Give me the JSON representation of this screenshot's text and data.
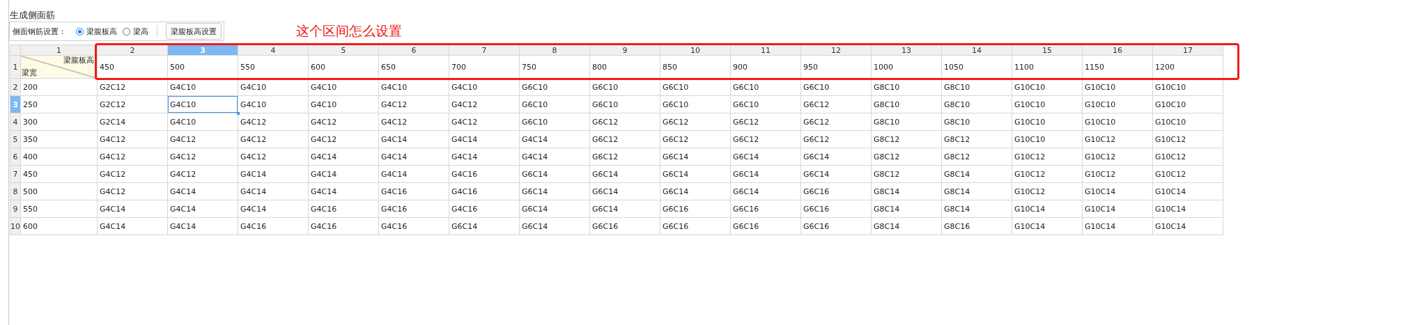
{
  "window": {
    "title": "生成侧面筋"
  },
  "toolbar": {
    "label": "侧面钢筋设置：",
    "options": [
      {
        "label": "梁腹板高",
        "selected": true
      },
      {
        "label": "梁高",
        "selected": false
      }
    ],
    "button": "梁腹板高设置"
  },
  "annotation": {
    "text": "这个区间怎么设置"
  },
  "table": {
    "columns": [
      {
        "label": "1",
        "selected": false
      },
      {
        "label": "2",
        "selected": false
      },
      {
        "label": "3",
        "selected": true
      },
      {
        "label": "4",
        "selected": false
      },
      {
        "label": "5",
        "selected": false
      },
      {
        "label": "6",
        "selected": false
      },
      {
        "label": "7",
        "selected": false
      },
      {
        "label": "8",
        "selected": false
      },
      {
        "label": "9",
        "selected": false
      },
      {
        "label": "10",
        "selected": false
      },
      {
        "label": "11",
        "selected": false
      },
      {
        "label": "12",
        "selected": false
      },
      {
        "label": "13",
        "selected": false
      },
      {
        "label": "14",
        "selected": false
      },
      {
        "label": "15",
        "selected": false
      },
      {
        "label": "16",
        "selected": false
      },
      {
        "label": "17",
        "selected": false
      }
    ],
    "corner": {
      "top_label": "梁腹板高",
      "bottom_label": "梁宽"
    },
    "header_row": {
      "label": "1",
      "selected": false,
      "values": [
        "450",
        "500",
        "550",
        "600",
        "650",
        "700",
        "750",
        "800",
        "850",
        "900",
        "950",
        "1000",
        "1050",
        "1100",
        "1150",
        "1200"
      ]
    },
    "rows": [
      {
        "label": "2",
        "selected": false,
        "cells": [
          "200",
          "G2C12",
          "G4C10",
          "G4C10",
          "G4C10",
          "G4C10",
          "G4C10",
          "G6C10",
          "G6C10",
          "G6C10",
          "G6C10",
          "G6C10",
          "G8C10",
          "G8C10",
          "G10C10",
          "G10C10",
          "G10C10"
        ]
      },
      {
        "label": "3",
        "selected": true,
        "cells": [
          "250",
          "G2C12",
          "G4C10",
          "G4C10",
          "G4C10",
          "G4C12",
          "G4C12",
          "G6C10",
          "G6C10",
          "G6C10",
          "G6C10",
          "G6C12",
          "G8C10",
          "G8C10",
          "G10C10",
          "G10C10",
          "G10C10"
        ]
      },
      {
        "label": "4",
        "selected": false,
        "cells": [
          "300",
          "G2C14",
          "G4C10",
          "G4C12",
          "G4C12",
          "G4C12",
          "G4C12",
          "G6C10",
          "G6C12",
          "G6C12",
          "G6C12",
          "G6C12",
          "G8C10",
          "G8C10",
          "G10C10",
          "G10C10",
          "G10C10"
        ]
      },
      {
        "label": "5",
        "selected": false,
        "cells": [
          "350",
          "G4C12",
          "G4C12",
          "G4C12",
          "G4C12",
          "G4C14",
          "G4C14",
          "G4C14",
          "G6C12",
          "G6C12",
          "G6C12",
          "G6C12",
          "G8C12",
          "G8C12",
          "G10C10",
          "G10C12",
          "G10C12"
        ]
      },
      {
        "label": "6",
        "selected": false,
        "cells": [
          "400",
          "G4C12",
          "G4C12",
          "G4C12",
          "G4C14",
          "G4C14",
          "G4C14",
          "G4C14",
          "G6C12",
          "G6C14",
          "G6C14",
          "G6C14",
          "G8C12",
          "G8C12",
          "G10C12",
          "G10C12",
          "G10C12"
        ]
      },
      {
        "label": "7",
        "selected": false,
        "cells": [
          "450",
          "G4C12",
          "G4C12",
          "G4C14",
          "G4C14",
          "G4C14",
          "G4C16",
          "G6C14",
          "G6C14",
          "G6C14",
          "G6C14",
          "G6C14",
          "G8C12",
          "G8C14",
          "G10C12",
          "G10C12",
          "G10C12"
        ]
      },
      {
        "label": "8",
        "selected": false,
        "cells": [
          "500",
          "G4C12",
          "G4C14",
          "G4C14",
          "G4C14",
          "G4C16",
          "G4C16",
          "G6C14",
          "G6C14",
          "G6C14",
          "G6C14",
          "G6C16",
          "G8C14",
          "G8C14",
          "G10C12",
          "G10C14",
          "G10C14"
        ]
      },
      {
        "label": "9",
        "selected": false,
        "cells": [
          "550",
          "G4C14",
          "G4C14",
          "G4C14",
          "G4C16",
          "G4C16",
          "G4C16",
          "G6C14",
          "G6C14",
          "G6C16",
          "G6C16",
          "G6C16",
          "G8C14",
          "G8C14",
          "G10C14",
          "G10C14",
          "G10C14"
        ]
      },
      {
        "label": "10",
        "selected": false,
        "cells": [
          "600",
          "G4C14",
          "G4C14",
          "G4C16",
          "G4C16",
          "G4C16",
          "G6C14",
          "G6C14",
          "G6C16",
          "G6C16",
          "G6C16",
          "G6C16",
          "G8C14",
          "G8C16",
          "G10C14",
          "G10C14",
          "G10C14"
        ]
      }
    ]
  }
}
